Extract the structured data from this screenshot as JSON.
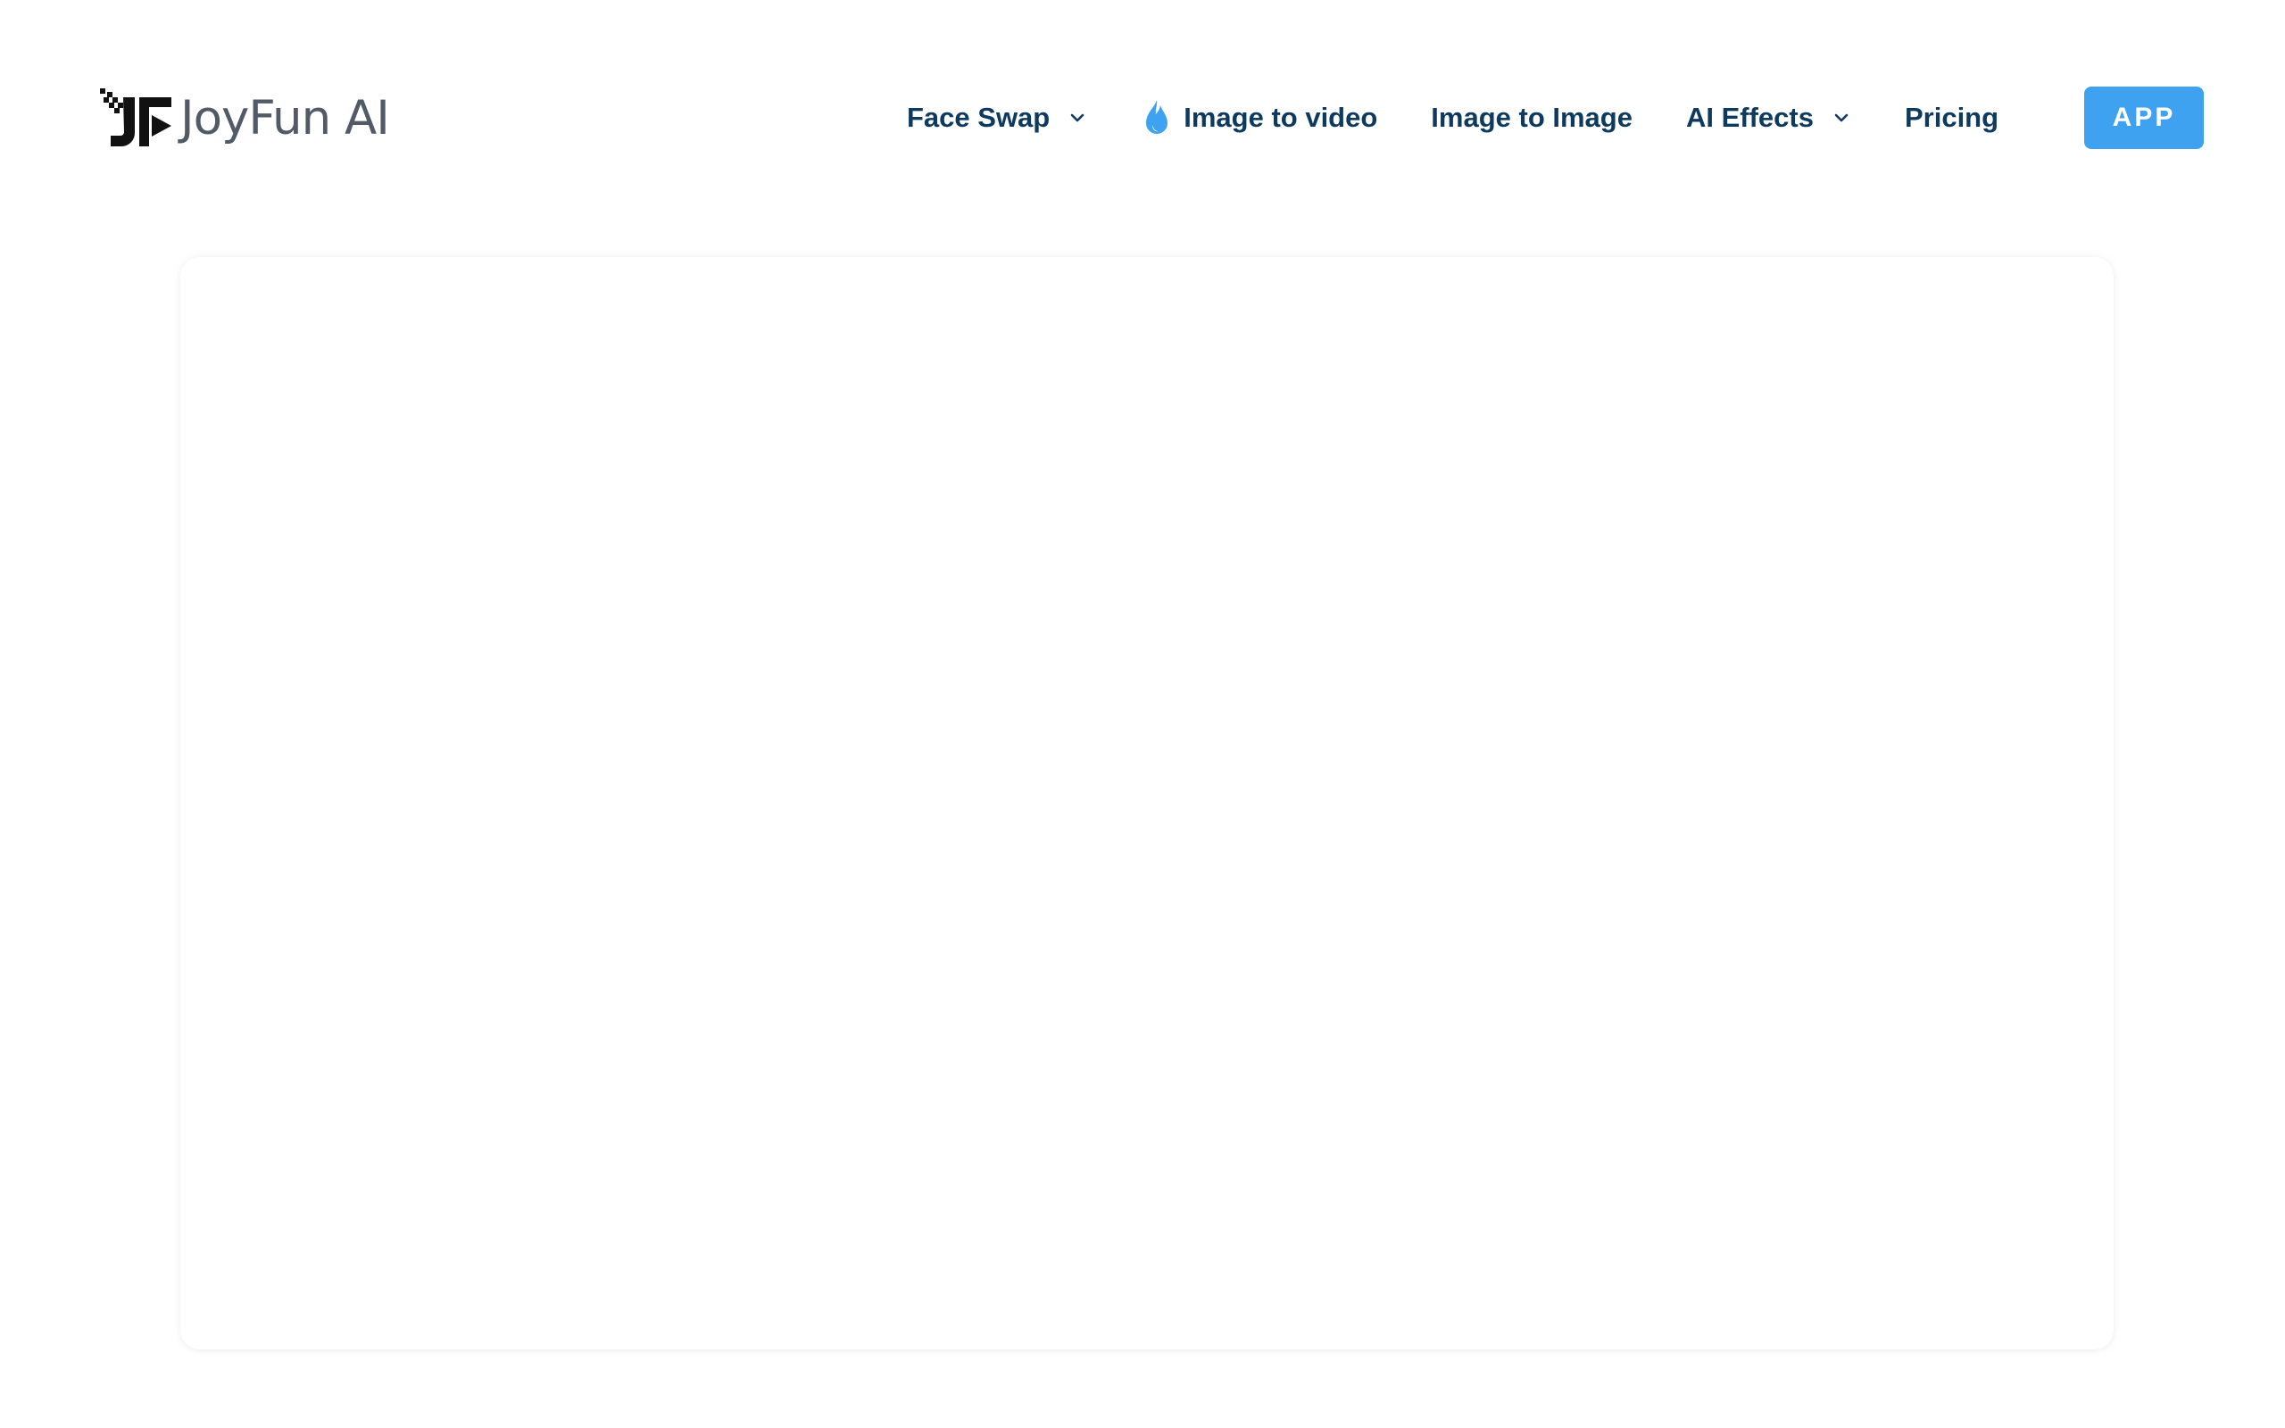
{
  "brand": {
    "name": "JoyFun AI",
    "logo_icon": "jf-play-logo-icon"
  },
  "nav": {
    "face_swap": {
      "label": "Face Swap",
      "icon": "chevron-down-icon"
    },
    "image_to_video": {
      "label": "Image to video",
      "icon": "flame-icon"
    },
    "image_to_image": {
      "label": "Image to Image"
    },
    "ai_effects": {
      "label": "AI Effects",
      "icon": "chevron-down-icon"
    },
    "pricing": {
      "label": "Pricing"
    }
  },
  "app_button": {
    "label": "APP"
  },
  "colors": {
    "nav_text": "#0f3a5f",
    "accent": "#3ea2f1",
    "logo_text": "#525a67",
    "logo_mark": "#111111"
  }
}
